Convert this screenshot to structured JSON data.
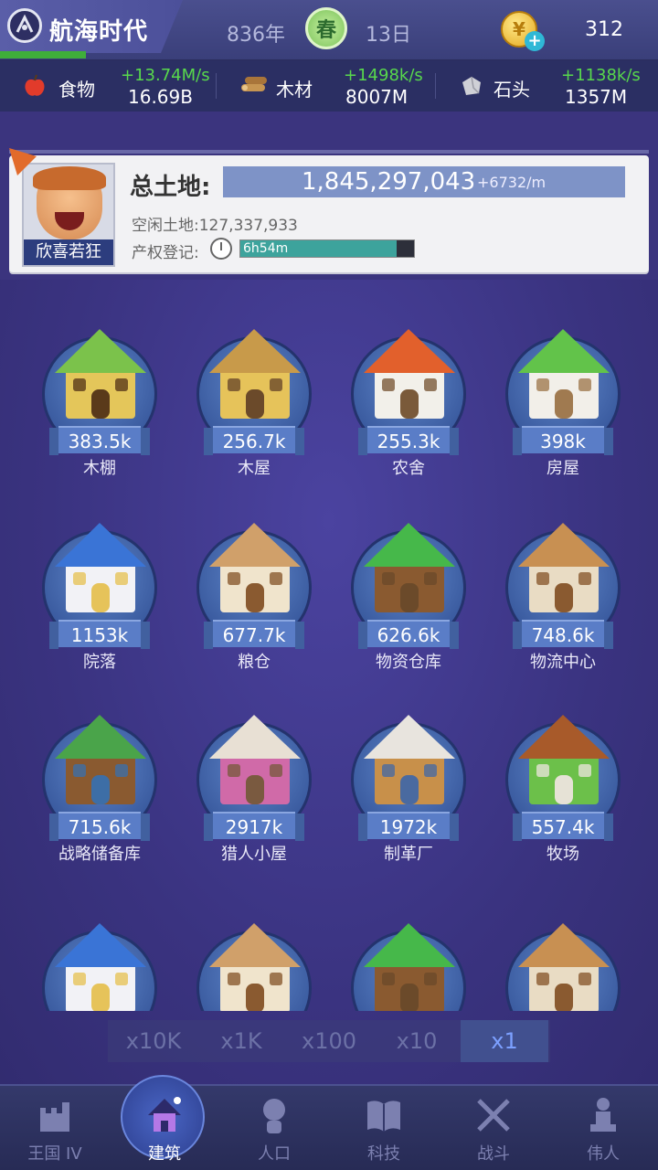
{
  "header": {
    "game_title": "航海时代",
    "year": "836年",
    "season": "春",
    "day": "13日",
    "coins": "312",
    "title_progress": 0.47
  },
  "resources": [
    {
      "name": "食物",
      "rate": "+13.74M/s",
      "total": "16.69B",
      "icon": "apple-icon",
      "color": "#e23b2b"
    },
    {
      "name": "木材",
      "rate": "+1498k/s",
      "total": "8007M",
      "icon": "logs-icon",
      "color": "#c69552"
    },
    {
      "name": "石头",
      "rate": "+1138k/s",
      "total": "1357M",
      "icon": "stone-icon",
      "color": "#cfd0d6"
    }
  ],
  "land": {
    "label": "总土地:",
    "value": "1,845,297,043",
    "rate": "+6732/m",
    "free_land": "空闲土地:127,337,933",
    "deed_label": "产权登记:",
    "deed_time": "6h54m",
    "deed_progress": 0.9,
    "mood": "欣喜若狂"
  },
  "buildings": [
    {
      "name": "木棚",
      "count": "383.5k",
      "icon": "leaf-shed-icon"
    },
    {
      "name": "木屋",
      "count": "256.7k",
      "icon": "wooden-hut-icon"
    },
    {
      "name": "农舍",
      "count": "255.3k",
      "icon": "farmhouse-icon"
    },
    {
      "name": "房屋",
      "count": "398k",
      "icon": "house-icon"
    },
    {
      "name": "院落",
      "count": "1153k",
      "icon": "courtyard-icon"
    },
    {
      "name": "粮仓",
      "count": "677.7k",
      "icon": "granary-icon"
    },
    {
      "name": "物资仓库",
      "count": "626.6k",
      "icon": "warehouse-icon"
    },
    {
      "name": "物流中心",
      "count": "748.6k",
      "icon": "logistics-center-icon"
    },
    {
      "name": "战略储备库",
      "count": "715.6k",
      "icon": "strategic-reserve-icon"
    },
    {
      "name": "猎人小屋",
      "count": "2917k",
      "icon": "hunter-hut-icon"
    },
    {
      "name": "制革厂",
      "count": "1972k",
      "icon": "tannery-icon"
    },
    {
      "name": "牧场",
      "count": "557.4k",
      "icon": "ranch-icon"
    }
  ],
  "buildings_partial": [
    {
      "icon": "workshop-icon"
    },
    {
      "icon": "red-roof-mill-icon"
    },
    {
      "icon": "market-stall-icon"
    },
    {
      "icon": "ice-factory-icon"
    }
  ],
  "multipliers": {
    "options": [
      "x10K",
      "x1K",
      "x100",
      "x10",
      "x1"
    ],
    "selected": "x1"
  },
  "nav": [
    {
      "label": "王国 IV",
      "icon": "castle-icon"
    },
    {
      "label": "建筑",
      "icon": "house-build-icon",
      "active": true
    },
    {
      "label": "人口",
      "icon": "person-icon"
    },
    {
      "label": "科技",
      "icon": "book-icon"
    },
    {
      "label": "战斗",
      "icon": "crossed-swords-icon"
    },
    {
      "label": "伟人",
      "icon": "statue-icon"
    }
  ]
}
